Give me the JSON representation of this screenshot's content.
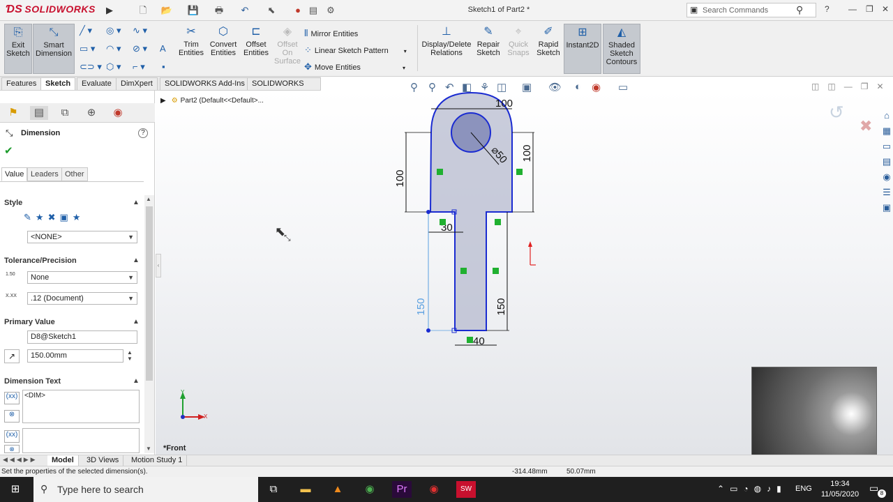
{
  "app": {
    "brand": "SOLIDWORKS",
    "doc_title": "Sketch1 of Part2 *"
  },
  "search": {
    "placeholder": "Search Commands"
  },
  "window_controls": {
    "help": "?",
    "minimize": "—",
    "restore": "❐",
    "close": "✕"
  },
  "quick_access_icons": [
    "new-icon",
    "open-icon",
    "save-icon",
    "print-icon",
    "undo-icon",
    "select-icon",
    "rebuild-icon",
    "options-icon"
  ],
  "command_manager": {
    "exit_sketch": "Exit Sketch",
    "smart_dimension": "Smart Dimension",
    "trim_entities": "Trim Entities",
    "convert_entities": "Convert Entities",
    "offset_entities": "Offset Entities",
    "offset_on_surface": "Offset On Surface",
    "mirror_entities": "Mirror Entities",
    "linear_sketch_pattern": "Linear Sketch Pattern",
    "move_entities": "Move Entities",
    "display_delete_relations": "Display/Delete Relations",
    "repair_sketch": "Repair Sketch",
    "quick_snaps": "Quick Snaps",
    "rapid_sketch": "Rapid Sketch",
    "instant2d": "Instant2D",
    "shaded_sketch_contours": "Shaded Sketch Contours"
  },
  "tabs": [
    "Features",
    "Sketch",
    "Evaluate",
    "DimXpert",
    "SOLIDWORKS Add-Ins",
    "SOLIDWORKS MBD"
  ],
  "active_tab": "Sketch",
  "property_manager": {
    "title": "Dimension",
    "help": "?",
    "subtabs": [
      "Value",
      "Leaders",
      "Other"
    ],
    "style": {
      "header": "Style",
      "favorite": "<NONE>"
    },
    "tolerance": {
      "header": "Tolerance/Precision",
      "type": "None",
      "precision": ".12 (Document)",
      "tol_icon_label": "1.50",
      "prec_icon_label": "X.XX"
    },
    "primary_value": {
      "header": "Primary Value",
      "name": "D8@Sketch1",
      "value": "150.00mm"
    },
    "dimension_text": {
      "header": "Dimension Text",
      "text": "<DIM>"
    }
  },
  "feature_tree": {
    "root": "Part2  (Default<<Default>..."
  },
  "sketch": {
    "dims": {
      "width_top": "100",
      "diameter": "⌀50",
      "height_left": "100",
      "height_right": "100",
      "neck": "30",
      "stem_left": "150",
      "stem_right": "150",
      "stem_width": "40"
    },
    "view_label": "*Front",
    "axis_x": "X",
    "axis_y": "Y"
  },
  "bottom_tabs": [
    "Model",
    "3D Views",
    "Motion Study 1"
  ],
  "active_bottom_tab": "Model",
  "status": {
    "message": "Set the properties of the selected dimension(s).",
    "x": "-314.48mm",
    "y": "50.07mm"
  },
  "taskbar": {
    "search_placeholder": "Type here to search",
    "lang": "ENG",
    "time": "19:34",
    "date": "11/05/2020",
    "notif_count": "8"
  },
  "colors": {
    "sketch_line": "#1a2bd1",
    "fill": "#b7bbcf",
    "dim": "#111111",
    "selected_dim": "#5aa0e0",
    "relation": "#20b030",
    "brand": "#c8102e"
  }
}
